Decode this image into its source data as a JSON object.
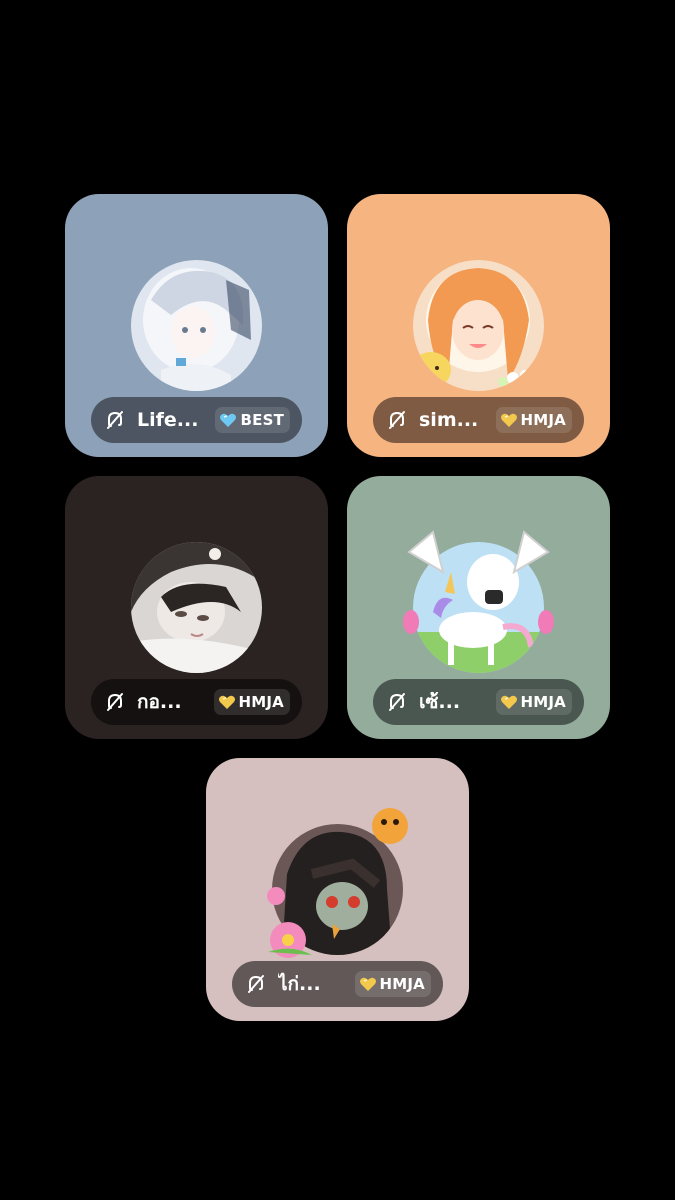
{
  "tiles": [
    {
      "name": "Life...",
      "badge": {
        "label": "BEST",
        "icon": "diamond-heart-icon",
        "color": "#6ec9f2"
      },
      "background": "#8da2b8",
      "muted": true
    },
    {
      "name": "sim...",
      "badge": {
        "label": "HMJA",
        "icon": "gold-heart-icon",
        "color": "#f2c94c"
      },
      "background": "#f5b480",
      "muted": true
    },
    {
      "name": "กอ...",
      "badge": {
        "label": "HMJA",
        "icon": "gold-heart-icon",
        "color": "#f2c94c"
      },
      "background": "#2b2322",
      "muted": true
    },
    {
      "name": "เซ้...",
      "badge": {
        "label": "HMJA",
        "icon": "gold-heart-icon",
        "color": "#f2c94c"
      },
      "background": "#93ac9b",
      "muted": true
    },
    {
      "name": "ไก่...",
      "badge": {
        "label": "HMJA",
        "icon": "gold-heart-icon",
        "color": "#f2c94c"
      },
      "background": "#d6c0bf",
      "muted": true
    }
  ]
}
